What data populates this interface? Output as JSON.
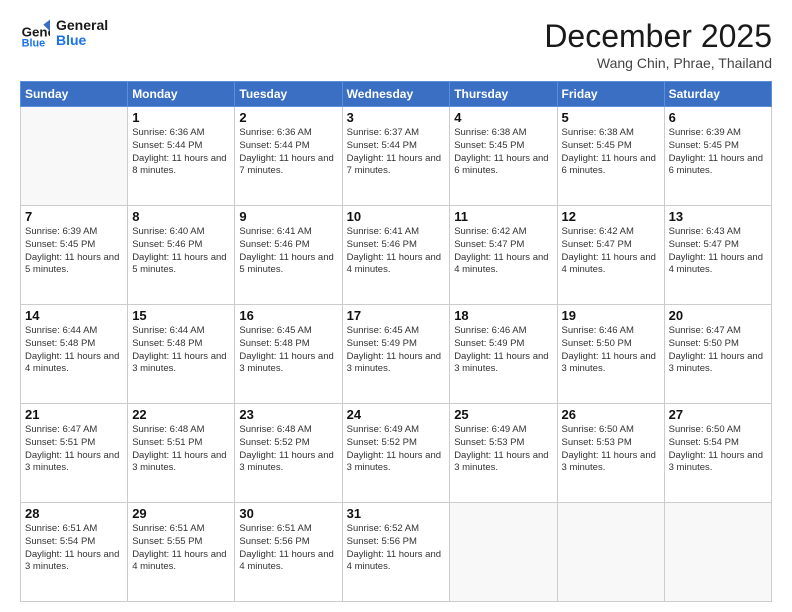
{
  "header": {
    "logo_line1": "General",
    "logo_line2": "Blue",
    "month": "December 2025",
    "location": "Wang Chin, Phrae, Thailand"
  },
  "days_of_week": [
    "Sunday",
    "Monday",
    "Tuesday",
    "Wednesday",
    "Thursday",
    "Friday",
    "Saturday"
  ],
  "weeks": [
    [
      {
        "day": "",
        "info": ""
      },
      {
        "day": "1",
        "info": "Sunrise: 6:36 AM\nSunset: 5:44 PM\nDaylight: 11 hours\nand 8 minutes."
      },
      {
        "day": "2",
        "info": "Sunrise: 6:36 AM\nSunset: 5:44 PM\nDaylight: 11 hours\nand 7 minutes."
      },
      {
        "day": "3",
        "info": "Sunrise: 6:37 AM\nSunset: 5:44 PM\nDaylight: 11 hours\nand 7 minutes."
      },
      {
        "day": "4",
        "info": "Sunrise: 6:38 AM\nSunset: 5:45 PM\nDaylight: 11 hours\nand 6 minutes."
      },
      {
        "day": "5",
        "info": "Sunrise: 6:38 AM\nSunset: 5:45 PM\nDaylight: 11 hours\nand 6 minutes."
      },
      {
        "day": "6",
        "info": "Sunrise: 6:39 AM\nSunset: 5:45 PM\nDaylight: 11 hours\nand 6 minutes."
      }
    ],
    [
      {
        "day": "7",
        "info": "Sunrise: 6:39 AM\nSunset: 5:45 PM\nDaylight: 11 hours\nand 5 minutes."
      },
      {
        "day": "8",
        "info": "Sunrise: 6:40 AM\nSunset: 5:46 PM\nDaylight: 11 hours\nand 5 minutes."
      },
      {
        "day": "9",
        "info": "Sunrise: 6:41 AM\nSunset: 5:46 PM\nDaylight: 11 hours\nand 5 minutes."
      },
      {
        "day": "10",
        "info": "Sunrise: 6:41 AM\nSunset: 5:46 PM\nDaylight: 11 hours\nand 4 minutes."
      },
      {
        "day": "11",
        "info": "Sunrise: 6:42 AM\nSunset: 5:47 PM\nDaylight: 11 hours\nand 4 minutes."
      },
      {
        "day": "12",
        "info": "Sunrise: 6:42 AM\nSunset: 5:47 PM\nDaylight: 11 hours\nand 4 minutes."
      },
      {
        "day": "13",
        "info": "Sunrise: 6:43 AM\nSunset: 5:47 PM\nDaylight: 11 hours\nand 4 minutes."
      }
    ],
    [
      {
        "day": "14",
        "info": "Sunrise: 6:44 AM\nSunset: 5:48 PM\nDaylight: 11 hours\nand 4 minutes."
      },
      {
        "day": "15",
        "info": "Sunrise: 6:44 AM\nSunset: 5:48 PM\nDaylight: 11 hours\nand 3 minutes."
      },
      {
        "day": "16",
        "info": "Sunrise: 6:45 AM\nSunset: 5:48 PM\nDaylight: 11 hours\nand 3 minutes."
      },
      {
        "day": "17",
        "info": "Sunrise: 6:45 AM\nSunset: 5:49 PM\nDaylight: 11 hours\nand 3 minutes."
      },
      {
        "day": "18",
        "info": "Sunrise: 6:46 AM\nSunset: 5:49 PM\nDaylight: 11 hours\nand 3 minutes."
      },
      {
        "day": "19",
        "info": "Sunrise: 6:46 AM\nSunset: 5:50 PM\nDaylight: 11 hours\nand 3 minutes."
      },
      {
        "day": "20",
        "info": "Sunrise: 6:47 AM\nSunset: 5:50 PM\nDaylight: 11 hours\nand 3 minutes."
      }
    ],
    [
      {
        "day": "21",
        "info": "Sunrise: 6:47 AM\nSunset: 5:51 PM\nDaylight: 11 hours\nand 3 minutes."
      },
      {
        "day": "22",
        "info": "Sunrise: 6:48 AM\nSunset: 5:51 PM\nDaylight: 11 hours\nand 3 minutes."
      },
      {
        "day": "23",
        "info": "Sunrise: 6:48 AM\nSunset: 5:52 PM\nDaylight: 11 hours\nand 3 minutes."
      },
      {
        "day": "24",
        "info": "Sunrise: 6:49 AM\nSunset: 5:52 PM\nDaylight: 11 hours\nand 3 minutes."
      },
      {
        "day": "25",
        "info": "Sunrise: 6:49 AM\nSunset: 5:53 PM\nDaylight: 11 hours\nand 3 minutes."
      },
      {
        "day": "26",
        "info": "Sunrise: 6:50 AM\nSunset: 5:53 PM\nDaylight: 11 hours\nand 3 minutes."
      },
      {
        "day": "27",
        "info": "Sunrise: 6:50 AM\nSunset: 5:54 PM\nDaylight: 11 hours\nand 3 minutes."
      }
    ],
    [
      {
        "day": "28",
        "info": "Sunrise: 6:51 AM\nSunset: 5:54 PM\nDaylight: 11 hours\nand 3 minutes."
      },
      {
        "day": "29",
        "info": "Sunrise: 6:51 AM\nSunset: 5:55 PM\nDaylight: 11 hours\nand 4 minutes."
      },
      {
        "day": "30",
        "info": "Sunrise: 6:51 AM\nSunset: 5:56 PM\nDaylight: 11 hours\nand 4 minutes."
      },
      {
        "day": "31",
        "info": "Sunrise: 6:52 AM\nSunset: 5:56 PM\nDaylight: 11 hours\nand 4 minutes."
      },
      {
        "day": "",
        "info": ""
      },
      {
        "day": "",
        "info": ""
      },
      {
        "day": "",
        "info": ""
      }
    ]
  ]
}
